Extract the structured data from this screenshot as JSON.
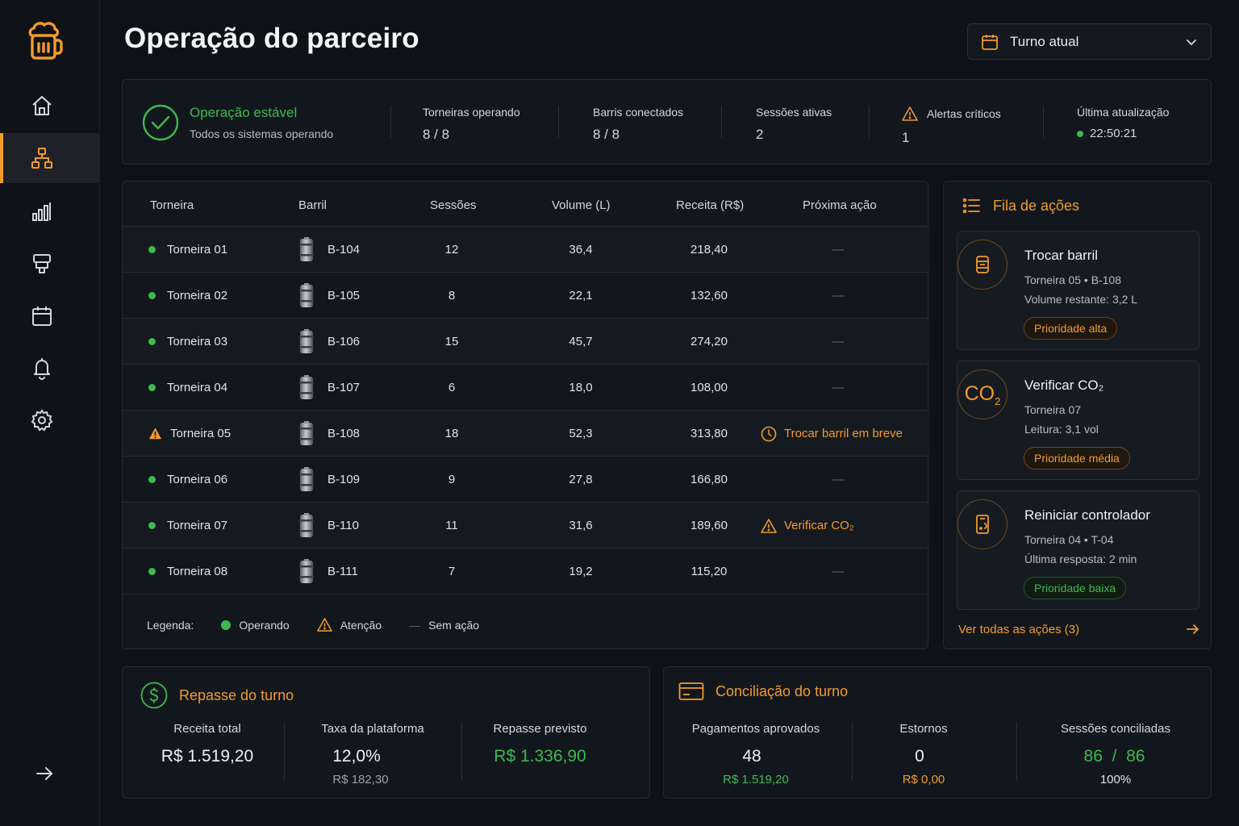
{
  "page": {
    "title": "Operação do parceiro"
  },
  "shift_select": {
    "value": "Turno atual"
  },
  "nav": {
    "items": [
      {
        "name": "home"
      },
      {
        "name": "operacao",
        "active": true
      },
      {
        "name": "relatorios"
      },
      {
        "name": "torneiras"
      },
      {
        "name": "agenda"
      },
      {
        "name": "alertas"
      },
      {
        "name": "configuracoes"
      }
    ]
  },
  "status": {
    "title": "Operação estável",
    "subtitle": "Todos os sistemas operando",
    "stats": [
      {
        "label": "Torneiras operando",
        "value": "8 / 8"
      },
      {
        "label": "Barris conectados",
        "value": "8 / 8"
      },
      {
        "label": "Sessões ativas",
        "value": "2"
      },
      {
        "label": "Alertas críticos",
        "value": "1"
      },
      {
        "label": "Última atualização",
        "value": "22:50:21"
      }
    ]
  },
  "table": {
    "headers": [
      "Torneira",
      "Barril",
      "Sessões",
      "Volume (L)",
      "Receita (R$)",
      "Próxima ação"
    ],
    "rows": [
      {
        "tap": "Torneira 01",
        "status": "ok",
        "keg": "B-104",
        "sessions": "12",
        "volume": "36,4",
        "revenue": "218,40",
        "action": "—"
      },
      {
        "tap": "Torneira 02",
        "status": "ok",
        "keg": "B-105",
        "sessions": "8",
        "volume": "22,1",
        "revenue": "132,60",
        "action": "—"
      },
      {
        "tap": "Torneira 03",
        "status": "ok",
        "keg": "B-106",
        "sessions": "15",
        "volume": "45,7",
        "revenue": "274,20",
        "action": "—"
      },
      {
        "tap": "Torneira 04",
        "status": "ok",
        "keg": "B-107",
        "sessions": "6",
        "volume": "18,0",
        "revenue": "108,00",
        "action": "—"
      },
      {
        "tap": "Torneira 05",
        "status": "warn",
        "keg": "B-108",
        "sessions": "18",
        "volume": "52,3",
        "revenue": "313,80",
        "action": "Trocar barril em breve",
        "action_icon": "clock"
      },
      {
        "tap": "Torneira 06",
        "status": "ok",
        "keg": "B-109",
        "sessions": "9",
        "volume": "27,8",
        "revenue": "166,80",
        "action": "—"
      },
      {
        "tap": "Torneira 07",
        "status": "ok",
        "keg": "B-110",
        "sessions": "11",
        "volume": "31,6",
        "revenue": "189,60",
        "action": "Verificar CO₂",
        "action_icon": "warning"
      },
      {
        "tap": "Torneira 08",
        "status": "ok",
        "keg": "B-111",
        "sessions": "7",
        "volume": "19,2",
        "revenue": "115,20",
        "action": "—"
      }
    ],
    "legend": {
      "label": "Legenda:",
      "operating": "Operando",
      "attention": "Atenção",
      "no_action_symbol": "—",
      "no_action": "Sem ação"
    }
  },
  "queue": {
    "title": "Fila de ações",
    "items": [
      {
        "title": "Trocar barril",
        "line1": "Torneira 05  •  B-108",
        "line2": "Volume restante: 3,2 L",
        "priority": "Prioridade alta",
        "level": "alta",
        "icon": "keg-icon"
      },
      {
        "title": "Verificar CO₂",
        "line1": "Torneira 07",
        "line2": "Leitura: 3,1 vol",
        "priority": "Prioridade média",
        "level": "media",
        "icon": "co2-icon",
        "icon_text": "CO",
        "icon_sub": "2"
      },
      {
        "title": "Reiniciar controlador",
        "line1": "Torneira 04  •  T-04",
        "line2": "Última resposta: 2 min",
        "priority": "Prioridade baixa",
        "level": "baixa",
        "icon": "controller-icon"
      }
    ],
    "see_all": "Ver todas as ações (3)"
  },
  "payout": {
    "title": "Repasse do turno",
    "metrics": [
      {
        "label": "Receita total",
        "value": "R$ 1.519,20"
      },
      {
        "label": "Taxa da plataforma",
        "value": "12,0%",
        "sub": "R$ 182,30"
      },
      {
        "label": "Repasse previsto",
        "value": "R$ 1.336,90"
      }
    ]
  },
  "reconciliation": {
    "title": "Conciliação do turno",
    "metrics": [
      {
        "label": "Pagamentos aprovados",
        "value": "48",
        "sub": "R$ 1.519,20"
      },
      {
        "label": "Estornos",
        "value": "0",
        "sub": "R$ 0,00"
      },
      {
        "label": "Sessões conciliadas",
        "value": "86  /  86",
        "sub": "100%"
      }
    ]
  },
  "colors": {
    "accent": "#f39a2b",
    "success": "#3fb950",
    "background": "#0e1217",
    "card": "#12171d"
  }
}
